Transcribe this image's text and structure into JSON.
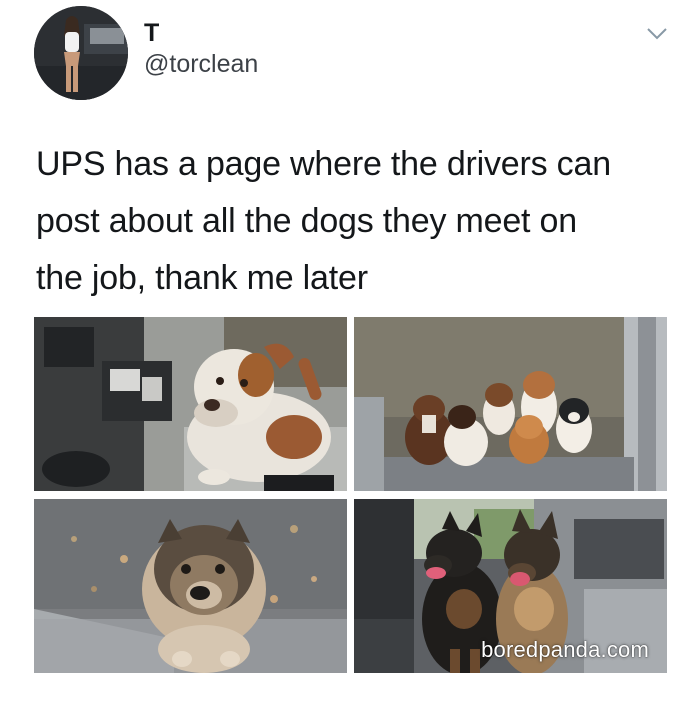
{
  "tweet": {
    "display_name": "T",
    "handle": "@torclean",
    "text_lines": [
      "UPS has a page where the drivers can",
      "post about all the dogs they meet on",
      "the job, thank me later"
    ],
    "menu_icon": "chevron-down-icon",
    "avatar_icon": "profile-photo"
  },
  "photos": [
    {
      "id": "dog-on-truck-step",
      "subject": "pitbull"
    },
    {
      "id": "puppies-at-truck-door",
      "subject": "puppies"
    },
    {
      "id": "fluffy-dog-looking-up",
      "subject": "akita"
    },
    {
      "id": "two-shepherds-in-truck",
      "subject": "shepherds"
    }
  ],
  "watermark": "boredpanda.com",
  "colors": {
    "text": "#14171a",
    "handle": "#3c4147",
    "background": "#ffffff"
  }
}
